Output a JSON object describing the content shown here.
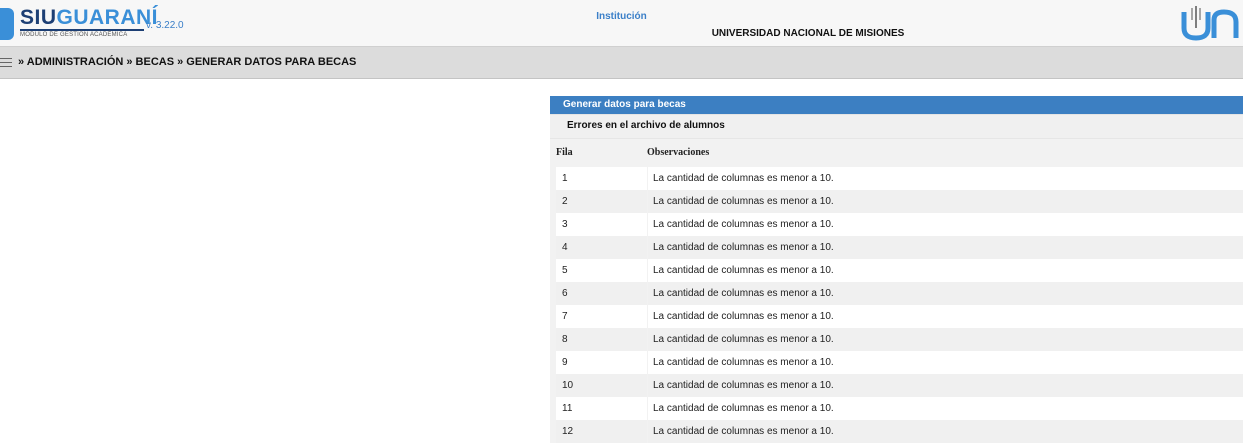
{
  "header": {
    "logo_siu": "SIU",
    "logo_guarani": "GUARANÍ",
    "logo_subtitle": "MÓDULO DE GESTIÓN ACADÉMICA",
    "version": "v. 3.22.0",
    "institution_label": "Institución",
    "institution_name": "UNIVERSIDAD NACIONAL DE MISIONES"
  },
  "breadcrumb": "» ADMINISTRACIÓN » BECAS »  GENERAR DATOS PARA BECAS",
  "panel": {
    "title": "Generar datos para becas",
    "subtitle": "Errores en el archivo de alumnos",
    "columns": [
      "Fila",
      "Observaciones"
    ],
    "rows": [
      {
        "fila": "1",
        "obs": "La cantidad de columnas es menor a 10."
      },
      {
        "fila": "2",
        "obs": "La cantidad de columnas es menor a 10."
      },
      {
        "fila": "3",
        "obs": "La cantidad de columnas es menor a 10."
      },
      {
        "fila": "4",
        "obs": "La cantidad de columnas es menor a 10."
      },
      {
        "fila": "5",
        "obs": "La cantidad de columnas es menor a 10."
      },
      {
        "fila": "6",
        "obs": "La cantidad de columnas es menor a 10."
      },
      {
        "fila": "7",
        "obs": "La cantidad de columnas es menor a 10."
      },
      {
        "fila": "8",
        "obs": "La cantidad de columnas es menor a 10."
      },
      {
        "fila": "9",
        "obs": "La cantidad de columnas es menor a 10."
      },
      {
        "fila": "10",
        "obs": "La cantidad de columnas es menor a 10."
      },
      {
        "fila": "11",
        "obs": "La cantidad de columnas es menor a 10."
      },
      {
        "fila": "12",
        "obs": "La cantidad de columnas es menor a 10."
      }
    ]
  },
  "colors": {
    "panel_header": "#3c7fc2",
    "brand_dark": "#1d3f74",
    "brand_light": "#3a8fd8"
  }
}
